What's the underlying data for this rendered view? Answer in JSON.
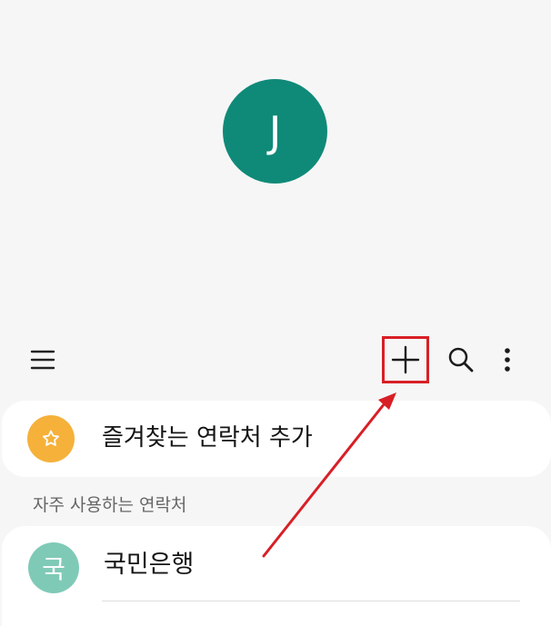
{
  "profile": {
    "initial": "J"
  },
  "toolbar": {
    "menu_icon": "menu-icon",
    "add_icon": "plus-icon",
    "search_icon": "search-icon",
    "more_icon": "more-vertical-icon"
  },
  "favorites": {
    "icon": "star-icon",
    "label": "즐겨찾는 연락처 추가"
  },
  "frequent": {
    "title": "자주 사용하는 연락처",
    "items": [
      {
        "initial": "국",
        "name": "국민은행"
      }
    ]
  },
  "colors": {
    "profile_avatar": "#0f8a78",
    "favorite_badge": "#f5b13a",
    "contact_avatar": "#7fcab7",
    "annotation_red": "#d81f26"
  }
}
